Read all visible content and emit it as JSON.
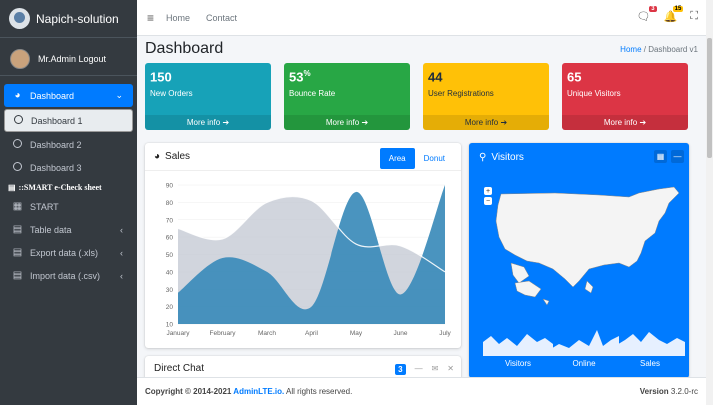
{
  "brand": {
    "name": "Napich-solution"
  },
  "user": {
    "name": "Mr.Admin Logout"
  },
  "sidebar": {
    "items": [
      {
        "label": "Dashboard",
        "icon": "tachometer-icon"
      },
      {
        "label": "Dashboard 1"
      },
      {
        "label": "Dashboard 2"
      },
      {
        "label": "Dashboard 3"
      }
    ],
    "header": "::SMART e-Check sheet",
    "items2": [
      {
        "label": "START",
        "icon": "grid-icon"
      },
      {
        "label": "Table data",
        "icon": "table-icon"
      },
      {
        "label": "Export data (.xls)",
        "icon": "table-icon"
      },
      {
        "label": "Import data (.csv)",
        "icon": "table-icon"
      }
    ]
  },
  "topnav": {
    "home": "Home",
    "contact": "Contact",
    "messages_count": "3",
    "notifications_count": "15"
  },
  "page": {
    "title": "Dashboard",
    "crumb_home": "Home",
    "crumb_current": "Dashboard v1"
  },
  "stat_boxes": [
    {
      "value": "150",
      "suffix": "",
      "label": "New Orders",
      "more": "More info",
      "color": "#17a2b8"
    },
    {
      "value": "53",
      "suffix": "%",
      "label": "Bounce Rate",
      "more": "More info",
      "color": "#28a745"
    },
    {
      "value": "44",
      "suffix": "",
      "label": "User Registrations",
      "more": "More info",
      "color": "#ffc107"
    },
    {
      "value": "65",
      "suffix": "",
      "label": "Unique Visitors",
      "more": "More info",
      "color": "#dc3545"
    }
  ],
  "sales": {
    "title": "Sales",
    "tab_area": "Area",
    "tab_donut": "Donut"
  },
  "chart_data": {
    "type": "area",
    "categories": [
      "January",
      "February",
      "March",
      "April",
      "May",
      "June",
      "July"
    ],
    "yticks": [
      10,
      20,
      30,
      40,
      50,
      60,
      70,
      80,
      90
    ],
    "ylim": [
      10,
      90
    ],
    "series": [
      {
        "values": [
          28,
          48,
          40,
          20,
          86,
          27,
          90
        ],
        "color": "#3b8bba"
      },
      {
        "values": [
          65,
          59,
          80,
          81,
          56,
          55,
          40
        ],
        "color": "#c1c7d1"
      }
    ]
  },
  "visitors": {
    "title": "Visitors",
    "labels": [
      "Visitors",
      "Online",
      "Sales"
    ]
  },
  "chat": {
    "title": "Direct Chat",
    "badge": "3"
  },
  "footer": {
    "copy": "Copyright © 2014-2021 ",
    "link": "AdminLTE.io.",
    "rights": " All rights reserved.",
    "version_label": "Version",
    "version": " 3.2.0-rc"
  }
}
